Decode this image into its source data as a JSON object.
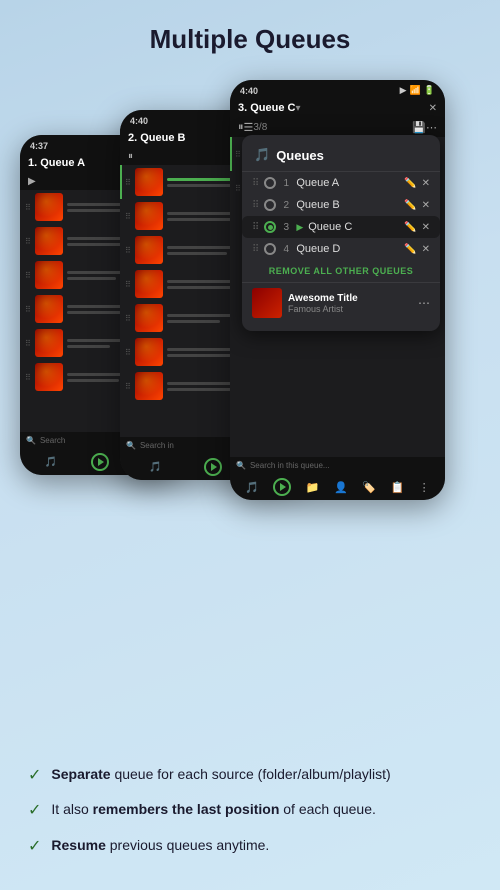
{
  "page": {
    "title": "Multiple Queues"
  },
  "phones": [
    {
      "id": "phone-1",
      "time": "4:37",
      "queue_name": "1. Queue A"
    },
    {
      "id": "phone-2",
      "time": "4:40",
      "queue_name": "2. Queue B"
    },
    {
      "id": "phone-3",
      "time": "4:40",
      "queue_name": "3. Queue C",
      "track_count": "3/8"
    }
  ],
  "queues_popup": {
    "title": "Queues",
    "items": [
      {
        "num": "1",
        "name": "Queue A",
        "active": false
      },
      {
        "num": "2",
        "name": "Queue B",
        "active": false
      },
      {
        "num": "3",
        "name": "Queue C",
        "active": true
      },
      {
        "num": "4",
        "name": "Queue D",
        "active": false
      }
    ],
    "remove_all_label": "REMOVE ALL OTHER QUEUES",
    "now_playing_title": "Awesome Title",
    "now_playing_artist": "Famous Artist"
  },
  "search": {
    "placeholder": "Search in this queue..."
  },
  "features": [
    {
      "bold_part": "Separate",
      "rest": " queue for each source (folder/album/playlist)"
    },
    {
      "plain_start": "It also ",
      "bold_part": "remembers the last position",
      "rest": " of each queue."
    },
    {
      "bold_part": "Resume",
      "rest": " previous queues anytime."
    }
  ]
}
